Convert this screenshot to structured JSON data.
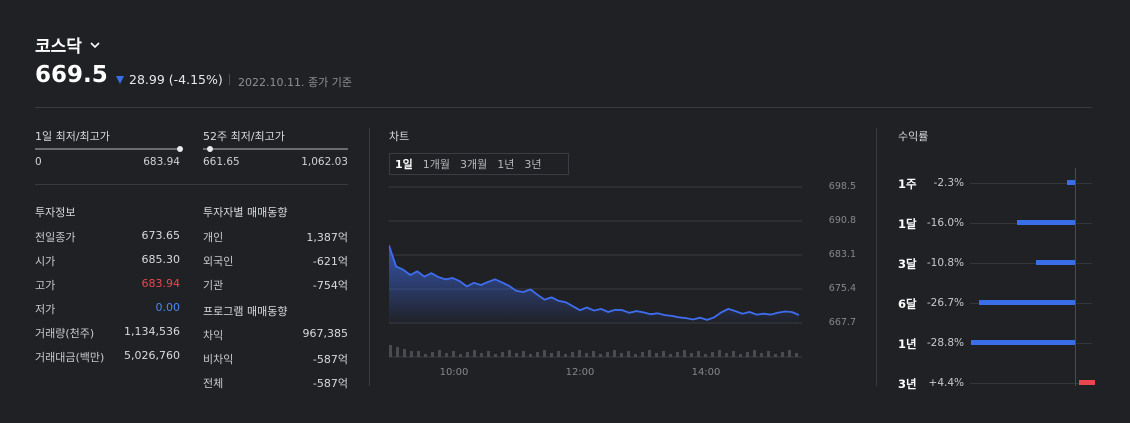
{
  "header": {
    "index_name": "코스닥",
    "price": "669.5",
    "change_text": "28.99 (-4.15%)",
    "date_text": "2022.10.11. 종가 기준",
    "accent_down": "#3a6ee8",
    "accent_up": "#e8474f"
  },
  "range_1d": {
    "label": "1일 최저/최고가",
    "low": "0",
    "high": "683.94",
    "marker_fraction": 0.997
  },
  "range_52w": {
    "label": "52주 최저/최고가",
    "low": "661.65",
    "high": "1,062.03",
    "marker_fraction": 0.02
  },
  "invest_info": {
    "title": "투자정보",
    "rows": [
      {
        "label": "전일종가",
        "value": "673.65",
        "color": "#d8d9dc"
      },
      {
        "label": "시가",
        "value": "685.30",
        "color": "#d8d9dc"
      },
      {
        "label": "고가",
        "value": "683.94",
        "color": "#e8474f"
      },
      {
        "label": "저가",
        "value": "0.00",
        "color": "#4d86f0"
      },
      {
        "label": "거래량(천주)",
        "value": "1,134,536",
        "color": "#d8d9dc"
      },
      {
        "label": "거래대금(백만)",
        "value": "5,026,760",
        "color": "#d8d9dc"
      }
    ]
  },
  "investor_trend": {
    "title": "투자자별 매매동향",
    "rows": [
      {
        "label": "개인",
        "value": "1,387억"
      },
      {
        "label": "외국인",
        "value": "-621억"
      },
      {
        "label": "기관",
        "value": "-754억"
      }
    ]
  },
  "program_trend": {
    "title": "프로그램 매매동향",
    "rows": [
      {
        "label": "차익",
        "value": "967,385"
      },
      {
        "label": "비차익",
        "value": "-587억"
      },
      {
        "label": "전체",
        "value": "-587억"
      }
    ]
  },
  "chart": {
    "title": "차트",
    "tabs": [
      "1일",
      "1개월",
      "3개월",
      "1년",
      "3년"
    ],
    "active_tab": "1일",
    "y_ticks": [
      "698.5",
      "690.8",
      "683.1",
      "675.4",
      "667.7"
    ],
    "x_ticks": [
      "10:00",
      "12:00",
      "14:00"
    ]
  },
  "chart_data": {
    "type": "area",
    "x_labels": [
      "10:00",
      "12:00",
      "14:00"
    ],
    "series": [
      {
        "values": [
          685.3,
          680.5,
          679.8,
          678.6,
          679.4,
          678.2,
          679.0,
          678.1,
          677.6,
          677.9,
          677.2,
          676.0,
          676.8,
          676.3,
          677.0,
          677.6,
          676.9,
          676.1,
          675.0,
          674.7,
          675.3,
          674.1,
          673.0,
          673.5,
          672.7,
          672.4,
          671.5,
          670.6,
          671.2,
          670.5,
          670.9,
          670.2,
          670.7,
          670.6,
          670.0,
          670.4,
          670.1,
          669.7,
          669.9,
          669.5,
          669.3,
          669.0,
          668.8,
          668.5,
          668.9,
          668.4,
          669.0,
          670.1,
          670.9,
          670.4,
          669.8,
          670.2,
          669.6,
          669.8,
          669.6,
          670.0,
          670.3,
          670.2,
          669.5
        ],
        "color": "#3f6df0"
      }
    ],
    "y_ticks": [
      698.5,
      690.8,
      683.1,
      675.4,
      667.7
    ],
    "ylim": [
      666.2,
      700.0
    ]
  },
  "returns": {
    "title": "수익률",
    "rows": [
      {
        "label": "1주",
        "value": "-2.3%",
        "pct": -2.3
      },
      {
        "label": "1달",
        "value": "-16.0%",
        "pct": -16.0
      },
      {
        "label": "3달",
        "value": "-10.8%",
        "pct": -10.8
      },
      {
        "label": "6달",
        "value": "-26.7%",
        "pct": -26.7
      },
      {
        "label": "1년",
        "value": "-28.8%",
        "pct": -28.8
      },
      {
        "label": "3년",
        "value": "+4.4%",
        "pct": 4.4
      }
    ]
  }
}
